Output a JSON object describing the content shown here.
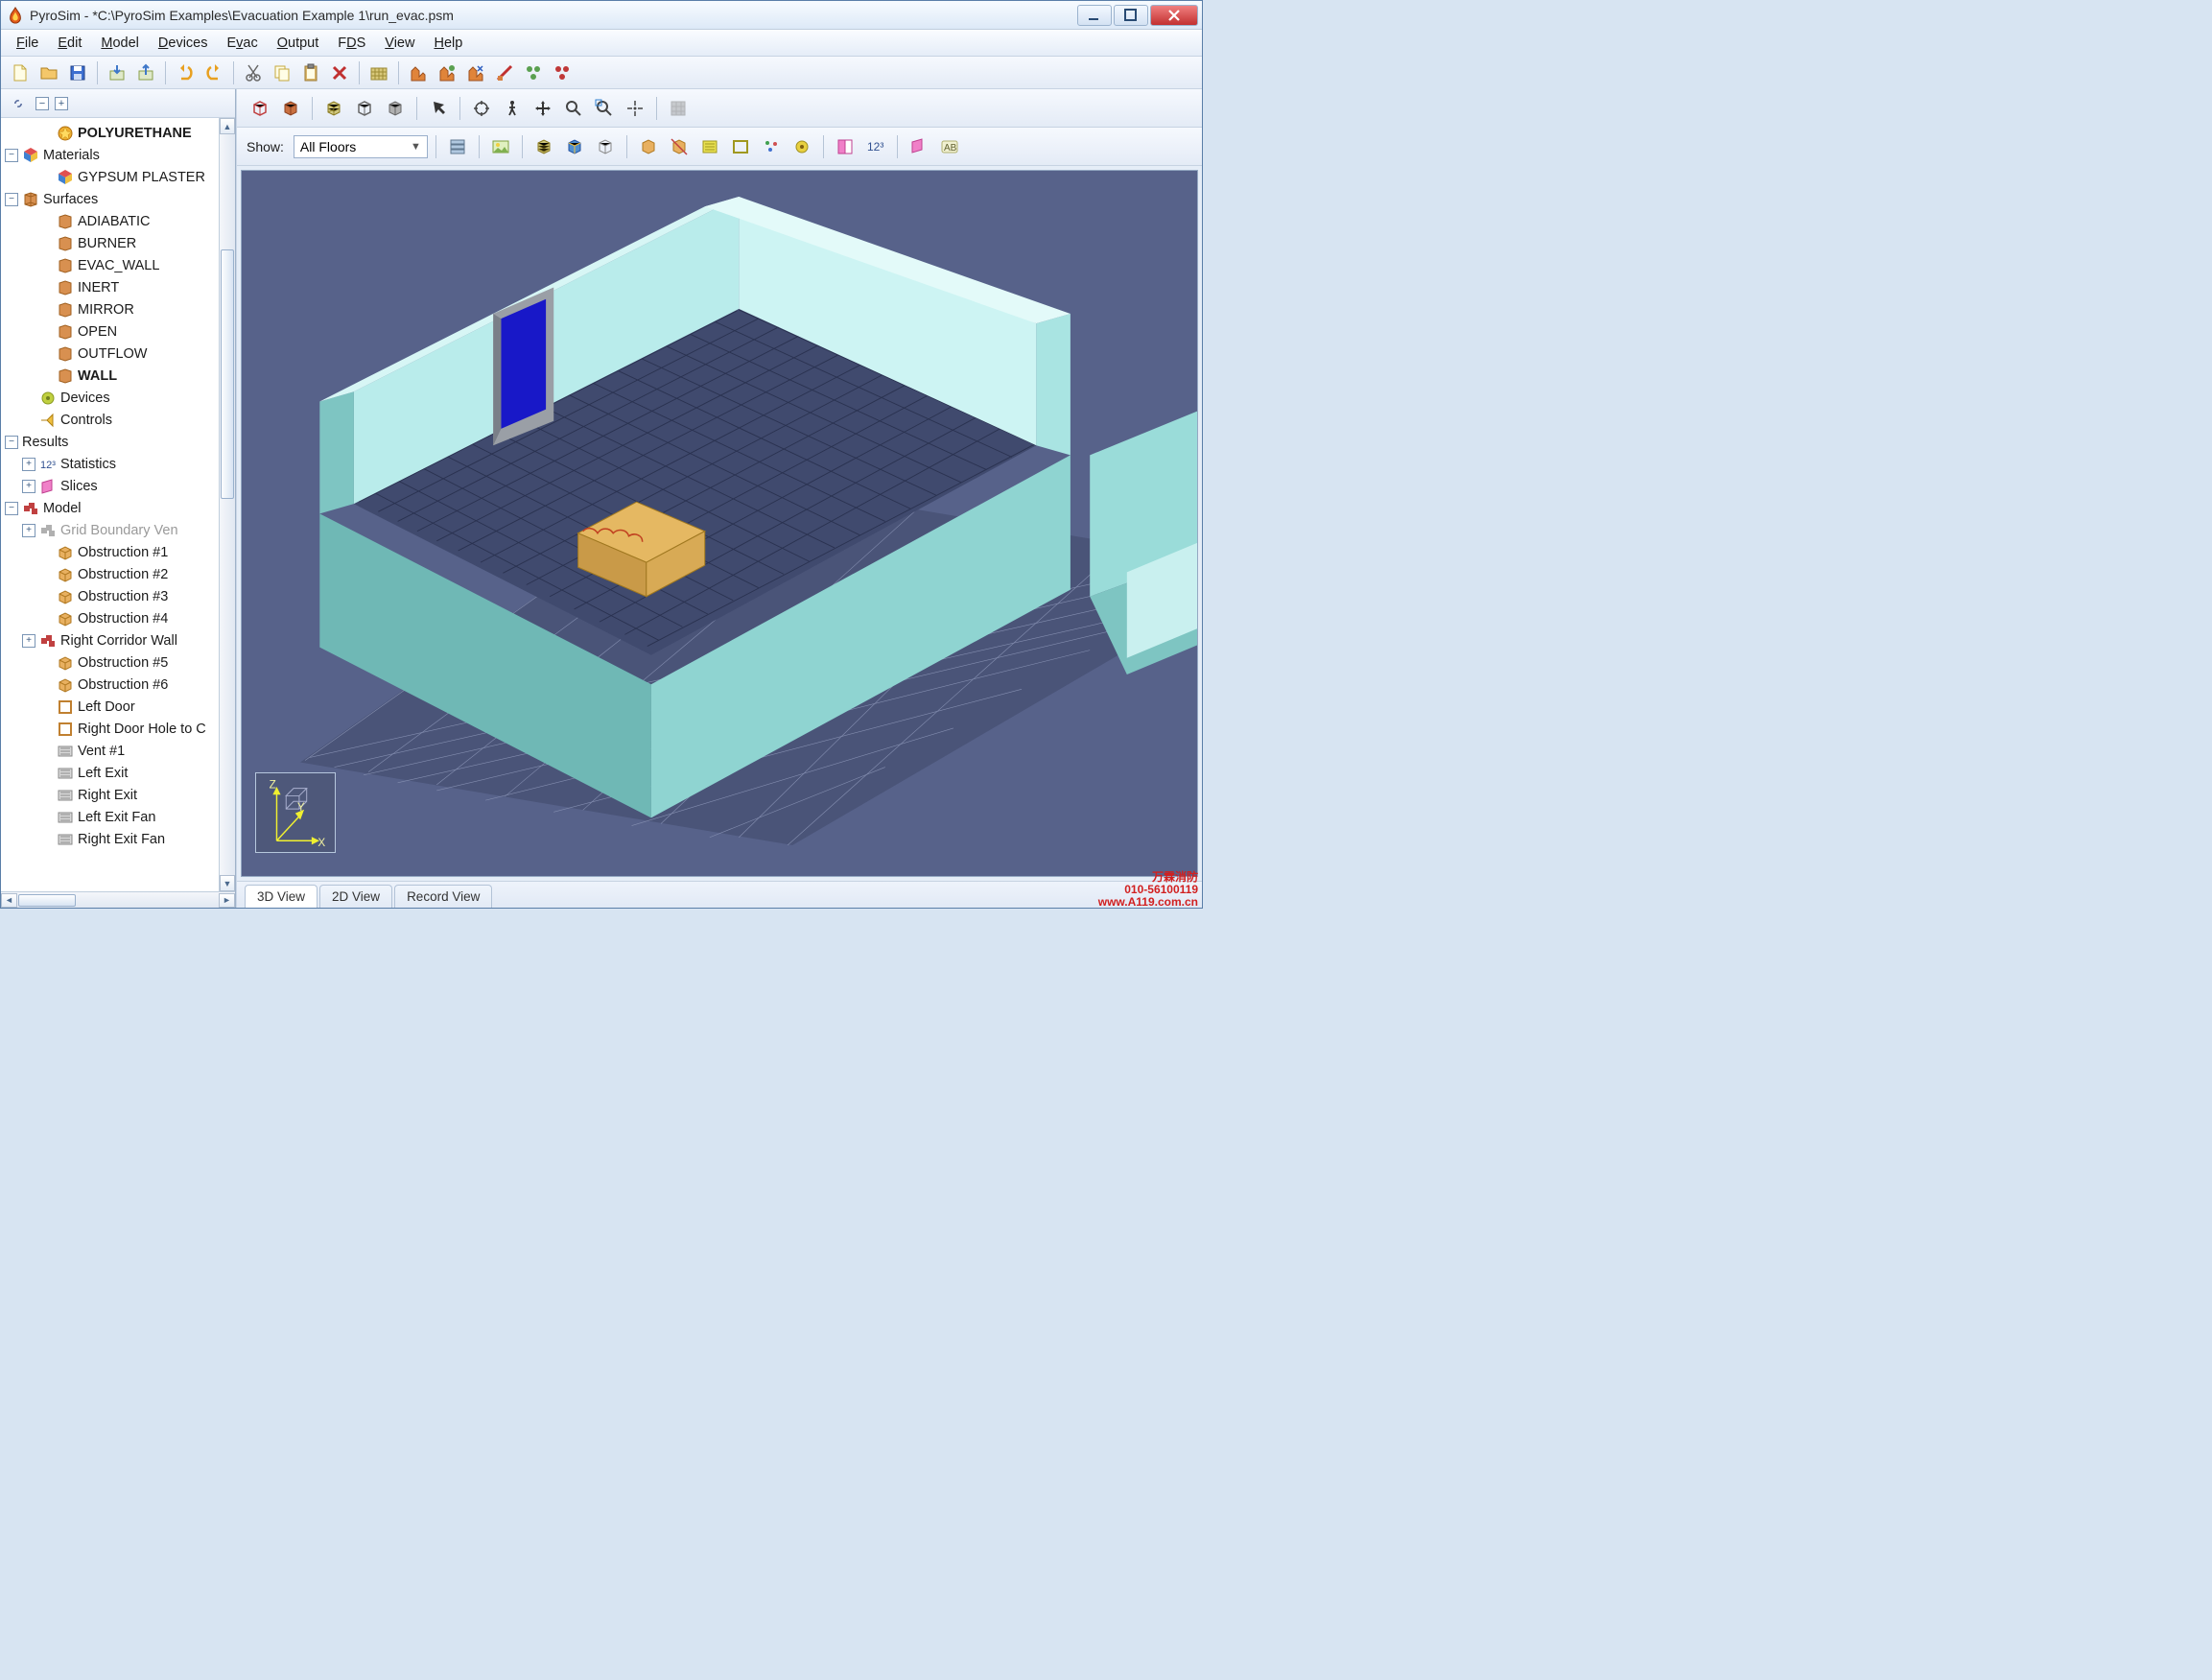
{
  "title": "PyroSim - *C:\\PyroSim Examples\\Evacuation Example 1\\run_evac.psm",
  "menu": {
    "file": "File",
    "edit": "Edit",
    "model": "Model",
    "devices": "Devices",
    "evac": "Evac",
    "output": "Output",
    "fds": "FDS",
    "view": "View",
    "help": "Help"
  },
  "tree": {
    "polyurethane": "POLYURETHANE",
    "materials": "Materials",
    "gypsum": "GYPSUM PLASTER",
    "surfaces": "Surfaces",
    "adiabatic": "ADIABATIC",
    "burner": "BURNER",
    "evac_wall": "EVAC_WALL",
    "inert": "INERT",
    "mirror": "MIRROR",
    "open": "OPEN",
    "outflow": "OUTFLOW",
    "wall": "WALL",
    "devices": "Devices",
    "controls": "Controls",
    "results": "Results",
    "statistics": "Statistics",
    "slices": "Slices",
    "model": "Model",
    "grid_boundary": "Grid Boundary Ven",
    "obs1": "Obstruction #1",
    "obs2": "Obstruction #2",
    "obs3": "Obstruction #3",
    "obs4": "Obstruction #4",
    "right_corridor": "Right Corridor Wall",
    "obs5": "Obstruction #5",
    "obs6": "Obstruction #6",
    "left_door": "Left Door",
    "right_door_hole": "Right Door Hole to C",
    "vent1": "Vent #1",
    "left_exit": "Left Exit",
    "right_exit": "Right Exit",
    "left_exit_fan": "Left Exit Fan",
    "right_exit_fan": "Right Exit Fan"
  },
  "right": {
    "show_label": "Show:",
    "floor_selected": "All Floors"
  },
  "viewtabs": {
    "t3d": "3D View",
    "t2d": "2D View",
    "trec": "Record View"
  },
  "axes": {
    "x": "X",
    "y": "Y",
    "z": "Z"
  },
  "watermark": {
    "line1": "万霖消防",
    "line2": "010-56100119",
    "line3": "www.A119.com.cn"
  }
}
